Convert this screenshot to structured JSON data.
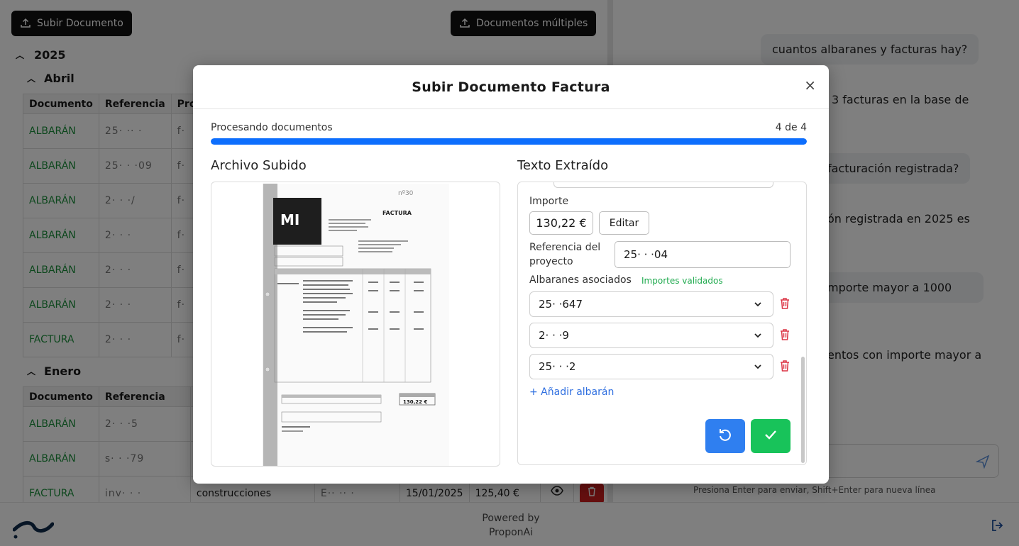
{
  "app": {
    "upload_button": "Subir Documento",
    "multi_button": "Documentos múltiples",
    "year": "2025",
    "months": [
      {
        "name": "Abril",
        "headers": [
          "Documento",
          "Referencia",
          "Prov"
        ],
        "rows": [
          {
            "doc": "ALBARÁN",
            "ref": "25· ·· ·",
            "prov": "f·"
          },
          {
            "doc": "ALBARÁN",
            "ref": "25· · ·09",
            "prov": "f·"
          },
          {
            "doc": "ALBARÁN",
            "ref": "2· · ·/",
            "prov": "f·"
          },
          {
            "doc": "ALBARÁN",
            "ref": "2· · ·",
            "prov": "f·"
          },
          {
            "doc": "ALBARÁN",
            "ref": "2· · ·",
            "prov": "f·"
          },
          {
            "doc": "ALBARÁN",
            "ref": "2· · ·",
            "prov": "f·"
          },
          {
            "doc": "FACTURA",
            "ref": "2· · ·",
            "prov": "f·"
          }
        ]
      },
      {
        "name": "Enero",
        "headers": [
          "Documento",
          "Referencia",
          ""
        ],
        "rows": [
          {
            "doc": "ALBARÁN",
            "ref": "2· · ·5",
            "prov": ""
          },
          {
            "doc": "ALBARÁN",
            "ref": "s· · ·79",
            "prov": ""
          },
          {
            "doc": "FACTURA",
            "ref": "inv· · ·",
            "prov": "construcciones",
            "extra_ref": "E·· ·· ·",
            "date": "15/01/2025",
            "amount": "125,40 €"
          }
        ]
      }
    ]
  },
  "chat": {
    "messages": [
      {
        "role": "user",
        "text": "cuantos albaranes y facturas hay?"
      },
      {
        "role": "assistant",
        "text": "3 facturas en la base de"
      },
      {
        "role": "user",
        "text": "facturación registrada?"
      },
      {
        "role": "assistant",
        "text": "ón registrada en 2025 es"
      },
      {
        "role": "user",
        "text": "mporte mayor a 1000"
      },
      {
        "role": "assistant",
        "text": "entos con importe mayor a"
      }
    ],
    "hint": "Presiona Enter para enviar, Shift+Enter para nueva línea"
  },
  "footer": {
    "powered_line1": "Powered by",
    "powered_line2": "ProponAi"
  },
  "modal": {
    "title": "Subir Documento Factura",
    "progress_label": "Procesando documentos",
    "progress_count": "4 de 4",
    "progress_fraction": 1.0,
    "left_title": "Archivo Subido",
    "right_title": "Texto Extraído",
    "invoice_heading": "FACTURA",
    "invoice_logo": "MI",
    "invoice_total": "130,22 €",
    "invoice_note": "nº30",
    "importe_label": "Importe",
    "importe_value": "130,22 €",
    "edit_label": "Editar",
    "ref_label": "Referencia del proyecto",
    "ref_value": "25· · ·04",
    "albaranes_label": "Albaranes asociados",
    "validated_label": "Importes validados",
    "albaranes": [
      "25· ·647",
      "2· · ·9",
      "25· · ·2"
    ],
    "add_label": "+ Añadir albarán"
  },
  "colors": {
    "accent_blue": "#0d6efd",
    "success_green": "#18c35a",
    "danger_red": "#dc3545",
    "link_green": "#1a8f3a"
  }
}
